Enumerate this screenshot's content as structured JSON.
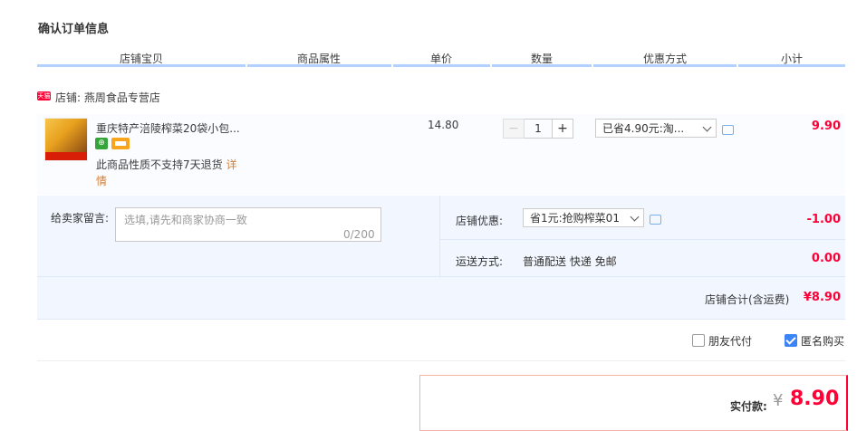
{
  "page_title": "确认订单信息",
  "columns": [
    "店铺宝贝",
    "商品属性",
    "单价",
    "数量",
    "优惠方式",
    "小计"
  ],
  "shop": {
    "badge": "天猫",
    "label": "店铺: 燕周食品专营店"
  },
  "item": {
    "title": "重庆特产涪陵榨菜20袋小包...",
    "no_return": "此商品性质不支持7天退货",
    "details_1": "详",
    "details_2": "情",
    "unit_price": "14.80",
    "minus": "−",
    "quantity": "1",
    "plus": "+",
    "discount": "已省4.90元:淘...",
    "subtotal": "9.90"
  },
  "options": {
    "message_label": "给卖家留言:",
    "message_placeholder": "选填,请先和商家协商一致",
    "message_count": "0/200",
    "shop_discount_label": "店铺优惠:",
    "shop_discount_value": "省1元:抢购榨菜01",
    "shop_discount_amount": "-1.00",
    "shipping_label": "运送方式:",
    "shipping_value": "普通配送 快递 免邮",
    "shipping_amount": "0.00",
    "total_label": "店铺合计(含运费)",
    "total_amount": "¥8.90"
  },
  "checkboxes": [
    {
      "label": "朋友代付",
      "checked": false
    },
    {
      "label": "匿名购买",
      "checked": true
    }
  ],
  "payment": {
    "label": "实付款:",
    "currency": "¥",
    "amount": "8.90"
  },
  "colors": {
    "accent": "#ff0036",
    "header_line": "#b2d1ff",
    "panel_bg": "#f2f7ff"
  }
}
